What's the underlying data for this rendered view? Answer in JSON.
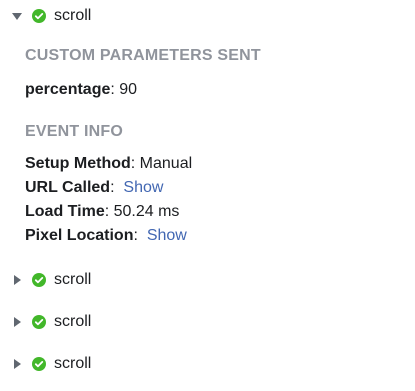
{
  "events": [
    {
      "name": "scroll",
      "expanded": true,
      "status_icon": "check-circle-icon",
      "status_color": "#42b72a"
    },
    {
      "name": "scroll",
      "expanded": false,
      "status_icon": "check-circle-icon",
      "status_color": "#42b72a"
    },
    {
      "name": "scroll",
      "expanded": false,
      "status_icon": "check-circle-icon",
      "status_color": "#42b72a"
    },
    {
      "name": "scroll",
      "expanded": false,
      "status_icon": "check-circle-icon",
      "status_color": "#42b72a"
    }
  ],
  "details": {
    "custom_params_heading": "CUSTOM PARAMETERS SENT",
    "params": [
      {
        "key": "percentage",
        "sep": ":",
        "value": " 90"
      }
    ],
    "event_info_heading": "EVENT INFO",
    "info": {
      "setup_method": {
        "key": "Setup Method",
        "sep": ":",
        "value": " Manual"
      },
      "url_called": {
        "key": "URL Called",
        "sep": ":",
        "link": "Show"
      },
      "load_time": {
        "key": "Load Time",
        "sep": ":",
        "value": " 50.24 ms"
      },
      "pixel_location": {
        "key": "Pixel Location",
        "sep": ":",
        "link": "Show"
      }
    }
  },
  "colors": {
    "heading": "#90949c",
    "text": "#1c1e21",
    "link": "#4267b2",
    "check": "#42b72a",
    "caret": "#606770"
  }
}
